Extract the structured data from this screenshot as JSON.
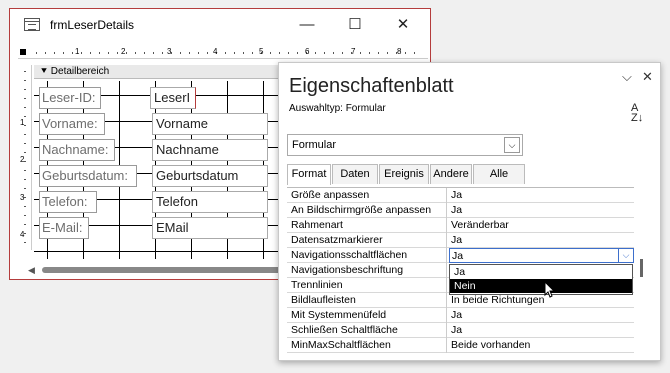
{
  "form_window": {
    "title": "frmLeserDetails",
    "minimize": "—",
    "maximize": "☐",
    "close": "✕",
    "section_label": "Detailbereich",
    "ruler_top": [
      "1",
      "2",
      "3",
      "4",
      "5",
      "6",
      "7",
      "8"
    ],
    "ruler_left": [
      "1",
      "2",
      "3",
      "4"
    ],
    "labels": [
      "Leser-ID:",
      "Vorname:",
      "Nachname:",
      "Geburtsdatum:",
      "Telefon:",
      "E-Mail:"
    ],
    "fields": [
      "LeserI",
      "Vorname",
      "Nachname",
      "Geburtsdatum",
      "Telefon",
      "EMail"
    ]
  },
  "property_sheet": {
    "title": "Eigenschaftenblatt",
    "selection_label": "Auswahltyp:",
    "selection_value": "Formular",
    "object_combo": "Formular",
    "tabs": [
      "Format",
      "Daten",
      "Ereignis",
      "Andere",
      "Alle"
    ],
    "active_tab": "Format",
    "rows": [
      {
        "name": "Größe anpassen",
        "value": "Ja"
      },
      {
        "name": "An Bildschirmgröße anpassen",
        "value": "Ja"
      },
      {
        "name": "Rahmenart",
        "value": "Veränderbar"
      },
      {
        "name": "Datensatzmarkierer",
        "value": "Ja"
      },
      {
        "name": "Navigationsschaltflächen",
        "value": "Ja"
      },
      {
        "name": "Navigationsbeschriftung",
        "value": ""
      },
      {
        "name": "Trennlinien",
        "value": ""
      },
      {
        "name": "Bildlaufleisten",
        "value": "In beide Richtungen"
      },
      {
        "name": "Mit Systemmenüfeld",
        "value": "Ja"
      },
      {
        "name": "Schließen Schaltfläche",
        "value": "Ja"
      },
      {
        "name": "MinMaxSchaltflächen",
        "value": "Beide vorhanden"
      }
    ],
    "dropdown_options": [
      "Ja",
      "Nein"
    ],
    "highlighted_option": "Nein"
  }
}
